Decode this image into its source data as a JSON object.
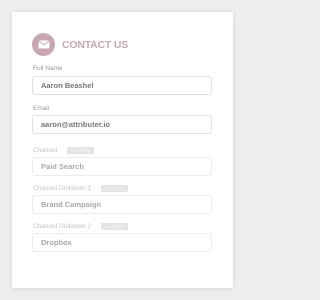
{
  "header": {
    "title": "CONTACT US",
    "icon": "mail-icon",
    "accent_color": "#c9a6b4"
  },
  "form": {
    "full_name": {
      "label": "Full Name",
      "value": "Aaron Beashel"
    },
    "email": {
      "label": "Email",
      "value": "aaron@attributer.io"
    },
    "channel": {
      "label": "Channel",
      "badge": "HIDDEN",
      "value": "Paid Search"
    },
    "channel_drilldown_1": {
      "label": "Channel Drilldown 1",
      "badge": "HIDDEN",
      "value": "Brand Campaign"
    },
    "channel_drilldown_2": {
      "label": "Channel Drilldown 2",
      "badge": "HIDDEN",
      "value": "Dropbox"
    }
  }
}
